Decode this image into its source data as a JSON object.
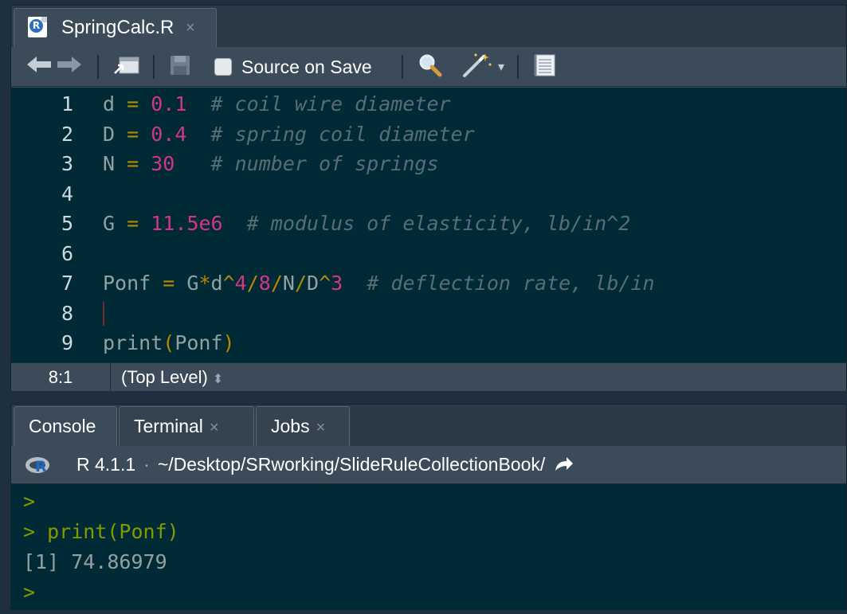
{
  "source": {
    "tab": {
      "filename": "SpringCalc.R",
      "close": "×",
      "icon": "r-file-icon"
    },
    "toolbar": {
      "back": "🡄",
      "forward": "🡆",
      "source_on_save_label": "Source on Save",
      "dropdown_caret": "▾"
    },
    "lines": [
      {
        "n": "1",
        "tokens": [
          [
            "var",
            "d"
          ],
          [
            "sp",
            " "
          ],
          [
            "op",
            "="
          ],
          [
            "sp",
            " "
          ],
          [
            "num",
            "0.1"
          ],
          [
            "sp",
            "  "
          ],
          [
            "com",
            "# coil wire diameter"
          ]
        ]
      },
      {
        "n": "2",
        "tokens": [
          [
            "var",
            "D"
          ],
          [
            "sp",
            " "
          ],
          [
            "op",
            "="
          ],
          [
            "sp",
            " "
          ],
          [
            "num",
            "0.4"
          ],
          [
            "sp",
            "  "
          ],
          [
            "com",
            "# spring coil diameter"
          ]
        ]
      },
      {
        "n": "3",
        "tokens": [
          [
            "var",
            "N"
          ],
          [
            "sp",
            " "
          ],
          [
            "op",
            "="
          ],
          [
            "sp",
            " "
          ],
          [
            "num",
            "30"
          ],
          [
            "sp",
            "   "
          ],
          [
            "com",
            "# number of springs"
          ]
        ]
      },
      {
        "n": "4",
        "tokens": []
      },
      {
        "n": "5",
        "tokens": [
          [
            "var",
            "G"
          ],
          [
            "sp",
            " "
          ],
          [
            "op",
            "="
          ],
          [
            "sp",
            " "
          ],
          [
            "num",
            "11.5e6"
          ],
          [
            "sp",
            "  "
          ],
          [
            "com",
            "# modulus of elasticity, lb/in^2"
          ]
        ]
      },
      {
        "n": "6",
        "tokens": []
      },
      {
        "n": "7",
        "tokens": [
          [
            "var",
            "Ponf"
          ],
          [
            "sp",
            " "
          ],
          [
            "op",
            "="
          ],
          [
            "sp",
            " "
          ],
          [
            "var",
            "G"
          ],
          [
            "op",
            "*"
          ],
          [
            "var",
            "d"
          ],
          [
            "op",
            "^"
          ],
          [
            "num",
            "4"
          ],
          [
            "op",
            "/"
          ],
          [
            "num",
            "8"
          ],
          [
            "op",
            "/"
          ],
          [
            "var",
            "N"
          ],
          [
            "op",
            "/"
          ],
          [
            "var",
            "D"
          ],
          [
            "op",
            "^"
          ],
          [
            "num",
            "3"
          ],
          [
            "sp",
            "  "
          ],
          [
            "com",
            "# deflection rate, lb/in"
          ]
        ]
      },
      {
        "n": "8",
        "tokens": []
      },
      {
        "n": "9",
        "tokens": [
          [
            "var",
            "print"
          ],
          [
            "paren",
            "("
          ],
          [
            "var",
            "Ponf"
          ],
          [
            "paren",
            ")"
          ]
        ]
      }
    ],
    "status": {
      "position": "8:1",
      "scope": "(Top Level)",
      "scope_arrows": "⬍"
    }
  },
  "console": {
    "tabs": [
      {
        "label": "Console",
        "active": true,
        "close": ""
      },
      {
        "label": "Terminal",
        "active": false,
        "close": "×"
      },
      {
        "label": "Jobs",
        "active": false,
        "close": "×"
      }
    ],
    "version": "R 4.1.1",
    "sep": "·",
    "path": "~/Desktop/SRworking/SlideRuleCollectionBook/",
    "path_icon": "forward-arrow-icon",
    "output": [
      {
        "kind": "prompt",
        "text": ">"
      },
      {
        "kind": "cmd",
        "text": "> print(Ponf)"
      },
      {
        "kind": "out",
        "text": "[1] 74.86979"
      },
      {
        "kind": "prompt",
        "text": ">"
      }
    ]
  },
  "colors": {
    "editor_bg": "#002b36",
    "comment": "#586e75",
    "number": "#d33682",
    "operator": "#b58900",
    "plain": "#93a1a1",
    "prompt": "#859900"
  }
}
